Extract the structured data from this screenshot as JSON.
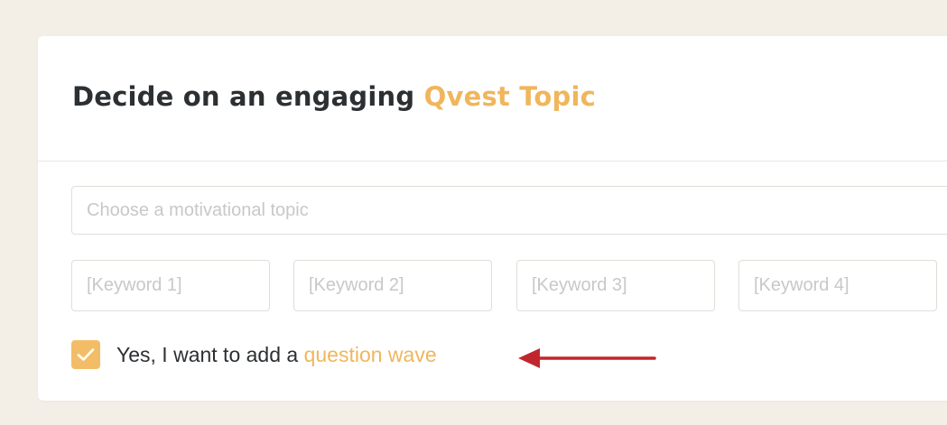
{
  "header": {
    "title_prefix": "Decide on an engaging ",
    "title_accent": "Qvest Topic"
  },
  "form": {
    "topic": {
      "value": "",
      "placeholder": "Choose a motivational topic"
    },
    "keywords": [
      {
        "value": "",
        "placeholder": "[Keyword 1]"
      },
      {
        "value": "",
        "placeholder": "[Keyword 2]"
      },
      {
        "value": "",
        "placeholder": "[Keyword 3]"
      },
      {
        "value": "",
        "placeholder": "[Keyword 4]"
      }
    ],
    "question_wave": {
      "checked": true,
      "label_prefix": "Yes, I want to add a ",
      "label_accent": "question wave"
    }
  },
  "colors": {
    "accent": "#f0b65c",
    "checkbox": "#f3bd68",
    "arrow": "#c0272d",
    "background": "#f3efe6",
    "text": "#2c3033"
  },
  "icons": {
    "checkmark": "checkmark-icon",
    "arrow": "arrow-left-icon"
  }
}
